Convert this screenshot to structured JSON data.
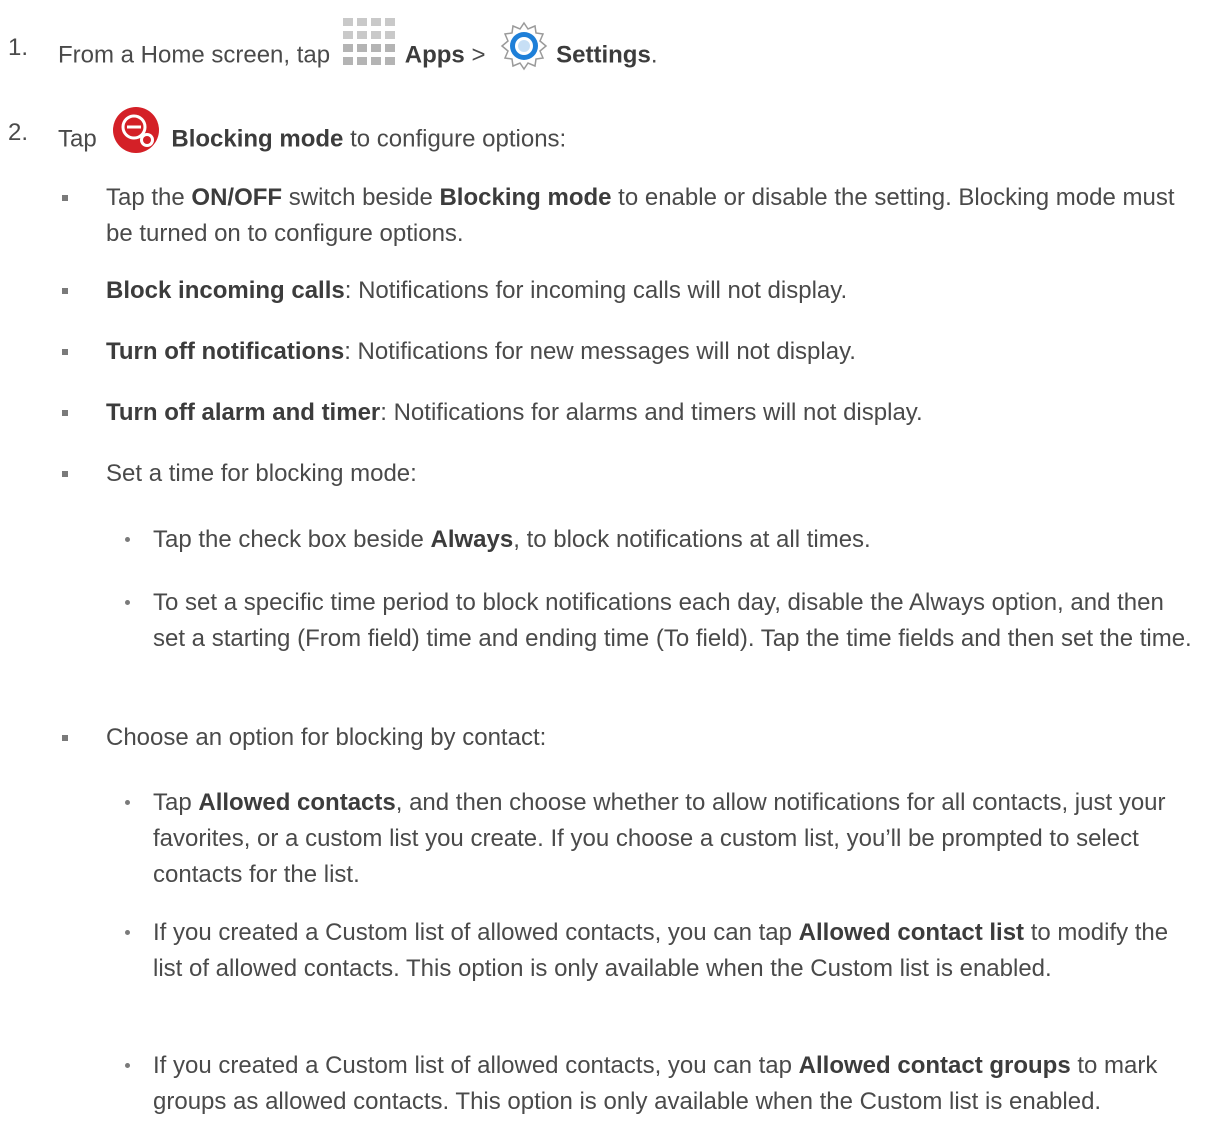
{
  "step1": {
    "number": "1.",
    "prefix": "From a Home screen, tap",
    "apps": "Apps",
    "sep": ">",
    "settings": "Settings",
    "suffix": "."
  },
  "step2": {
    "number": "2.",
    "prefix": "Tap",
    "label": "Blocking mode",
    "suffix": "to configure options:"
  },
  "b1": {
    "t1": "Tap the ",
    "s1": "ON/OFF",
    "t2": " switch beside ",
    "s2": "Blocking mode",
    "t3": " to enable or disable the setting. Blocking mode must be turned on to configure options."
  },
  "b2": {
    "s": "Block incoming calls",
    "t": ": Notifications for incoming calls will not display."
  },
  "b3": {
    "s": "Turn off notifications",
    "t": ": Notifications for new messages will not display."
  },
  "b4": {
    "s": "Turn off alarm and timer",
    "t": ": Notifications for alarms and timers will not display."
  },
  "b5": {
    "t": "Set a time for blocking mode:"
  },
  "d1": {
    "t1": "Tap the check box beside ",
    "s": "Always",
    "t2": ", to block notifications at all times."
  },
  "d2": {
    "t": "To set a specific time period to block notifications each day, disable the Always option, and then set a starting (From field) time and ending time (To field). Tap the time fields and then set the time."
  },
  "b6": {
    "t": "Choose an option for blocking by contact:"
  },
  "d3": {
    "t1": "Tap ",
    "s": "Allowed contacts",
    "t2": ", and then choose whether to allow notifications for all contacts, just your favorites, or a custom list you create. If you choose a custom list, you’ll be prompted to select contacts for the list."
  },
  "d4": {
    "t1": "If you created a Custom list of allowed contacts, you can tap ",
    "s": "Allowed contact list",
    "t2": " to modify the list of allowed contacts. This option is only available when the Custom list is enabled."
  },
  "d5": {
    "t1": "If you created a Custom list of allowed contacts, you can tap ",
    "s": "Allowed contact groups",
    "t2": " to mark groups as allowed contacts. This option is only available when the Custom list is enabled."
  },
  "icons": {
    "apps": "apps-grid-icon",
    "settings": "settings-gear-icon",
    "blocking": "blocking-mode-icon"
  },
  "colors": {
    "text": "#4a4a4a",
    "blocking_red": "#d42027",
    "settings_blue": "#1e7fd8"
  }
}
